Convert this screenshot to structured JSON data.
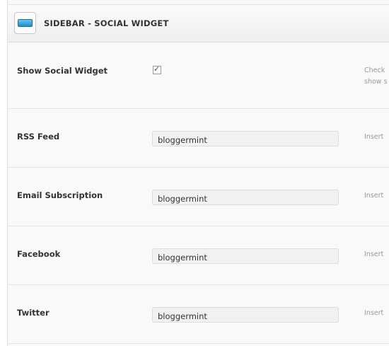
{
  "section": {
    "title": "SIDEBAR - SOCIAL WIDGET",
    "icon": "panel-icon",
    "accent": "#2a9ee2"
  },
  "show_widget": {
    "label": "Show Social Widget",
    "checked": true,
    "desc_line1": "Check",
    "desc_line2": "show s"
  },
  "fields": [
    {
      "label": "RSS Feed",
      "value": "bloggermint",
      "desc": "Insert"
    },
    {
      "label": "Email Subscription",
      "value": "bloggermint",
      "desc": "Insert"
    },
    {
      "label": "Facebook",
      "value": "bloggermint",
      "desc": "Insert"
    },
    {
      "label": "Twitter",
      "value": "bloggermint",
      "desc": "Insert"
    }
  ]
}
